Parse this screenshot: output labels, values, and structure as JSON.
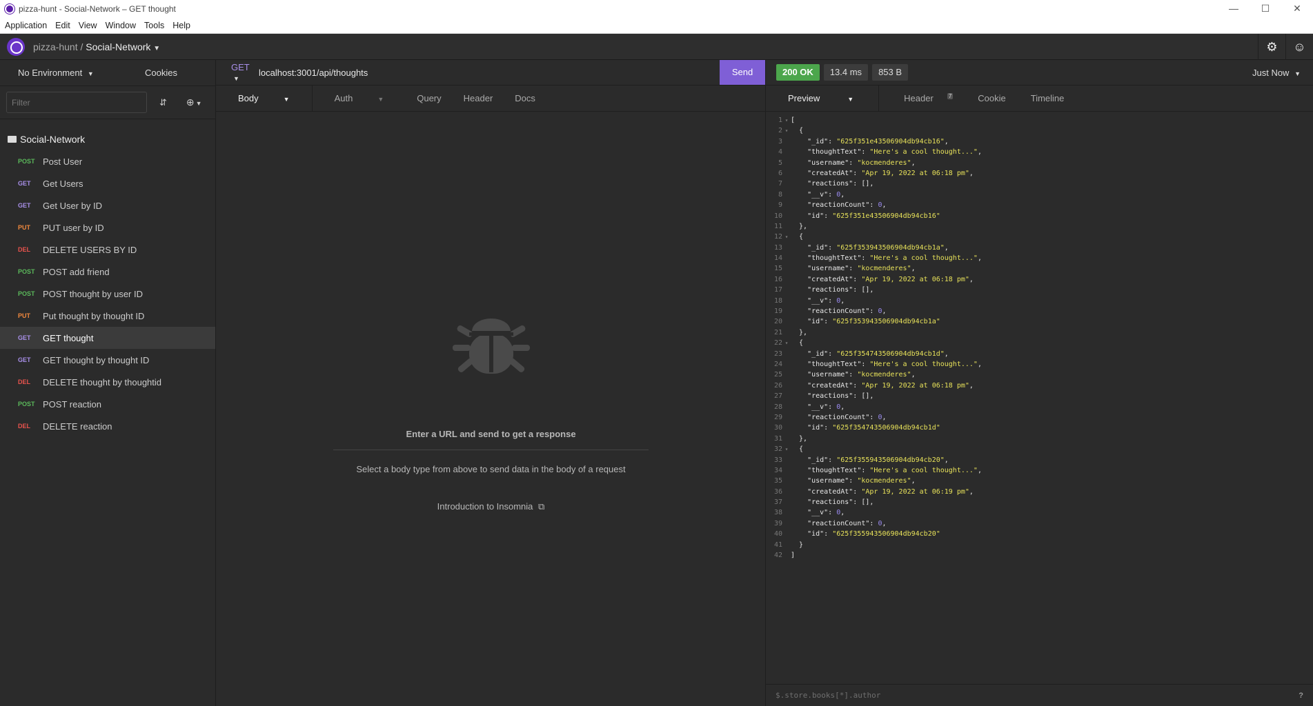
{
  "window": {
    "title": "pizza-hunt - Social-Network – GET thought",
    "controls": [
      "—",
      "☐",
      "✕"
    ]
  },
  "menu": [
    "Application",
    "Edit",
    "View",
    "Window",
    "Tools",
    "Help"
  ],
  "header": {
    "workspace": "pizza-hunt",
    "separator": "/",
    "collection": "Social-Network"
  },
  "sidebar": {
    "environment": "No Environment",
    "cookies": "Cookies",
    "filter_placeholder": "Filter",
    "folder": "Social-Network",
    "requests": [
      {
        "method": "POST",
        "name": "Post User"
      },
      {
        "method": "GET",
        "name": "Get Users"
      },
      {
        "method": "GET",
        "name": "Get User by ID"
      },
      {
        "method": "PUT",
        "name": "PUT user by ID"
      },
      {
        "method": "DEL",
        "name": "DELETE USERS BY ID"
      },
      {
        "method": "POST",
        "name": "POST add friend"
      },
      {
        "method": "POST",
        "name": "POST thought by user ID"
      },
      {
        "method": "PUT",
        "name": "Put thought by thought ID"
      },
      {
        "method": "GET",
        "name": "GET thought",
        "active": true
      },
      {
        "method": "GET",
        "name": "GET thought by thought ID"
      },
      {
        "method": "DEL",
        "name": "DELETE thought by thoughtid"
      },
      {
        "method": "POST",
        "name": "POST reaction"
      },
      {
        "method": "DEL",
        "name": "DELETE reaction"
      }
    ]
  },
  "request": {
    "method": "GET",
    "url": "localhost:3001/api/thoughts",
    "send_label": "Send",
    "tabs": [
      "Body",
      "Auth",
      "Query",
      "Header",
      "Docs"
    ],
    "empty_title": "Enter a URL and send to get a response",
    "empty_subtitle": "Select a body type from above to send data in the body of a request",
    "intro_link": "Introduction to Insomnia"
  },
  "response": {
    "status": "200 OK",
    "time": "13.4 ms",
    "size": "853 B",
    "time_ago": "Just Now",
    "tabs": [
      "Preview",
      "Header",
      "Cookie",
      "Timeline"
    ],
    "header_count": "7",
    "filter_placeholder": "$.store.books[*].author",
    "help": "?",
    "body": [
      {
        "_id": "625f351e43506904db94cb16",
        "createdAt": "Apr 19, 2022 at 06:18 pm"
      },
      {
        "_id": "625f353943506904db94cb1a",
        "createdAt": "Apr 19, 2022 at 06:18 pm"
      },
      {
        "_id": "625f354743506904db94cb1d",
        "createdAt": "Apr 19, 2022 at 06:18 pm"
      },
      {
        "_id": "625f355943506904db94cb20",
        "createdAt": "Apr 19, 2022 at 06:19 pm"
      }
    ],
    "common": {
      "thoughtText": "Here's a cool thought...",
      "username": "kocmenderes",
      "reactions": "[]",
      "__v": "0",
      "reactionCount": "0"
    }
  },
  "colors": {
    "accent": "#7f5fd6",
    "ok": "#4ca64c",
    "post": "#5bb85b",
    "get": "#a88fe8",
    "put": "#f0883e",
    "del": "#e8534d"
  }
}
